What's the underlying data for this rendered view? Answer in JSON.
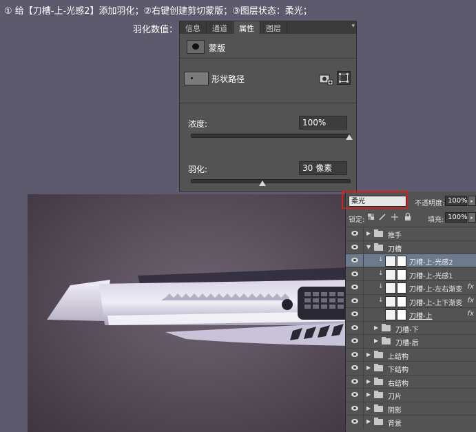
{
  "instruction": "① 给【刀槽-上-光感2】添加羽化；②右键创建剪切蒙版；③图层状态：柔光；",
  "feather_label": "羽化数值：",
  "properties_panel": {
    "tabs": [
      "信息",
      "通道",
      "属性",
      "图层"
    ],
    "active_tab": "属性",
    "mask_label": "蒙版",
    "shape_path_label": "形状路径",
    "density_label": "浓度:",
    "density_value": "100%",
    "density_level": 100,
    "feather_label": "羽化:",
    "feather_value": "30 像素",
    "feather_level": 0.45
  },
  "layers_panel": {
    "blend_mode": "柔光",
    "opacity_label": "不透明度:",
    "opacity_value": "100%",
    "lock_label": "锁定:",
    "fill_label": "填充:",
    "fill_value": "100%",
    "layers": [
      {
        "name": "推手",
        "type": "folder",
        "indent": 0,
        "open": false
      },
      {
        "name": "刀槽",
        "type": "folder",
        "indent": 0,
        "open": true
      },
      {
        "name": "刀槽-上-光感2",
        "type": "layer",
        "indent": 1,
        "clip": true,
        "selected": true,
        "fx": false
      },
      {
        "name": "刀槽-上-光感1",
        "type": "layer",
        "indent": 1,
        "clip": true,
        "fx": false
      },
      {
        "name": "刀槽-上-左右渐变",
        "type": "layer",
        "indent": 1,
        "clip": true,
        "fx": true
      },
      {
        "name": "刀槽-上-上下渐变",
        "type": "layer",
        "indent": 1,
        "clip": true,
        "fx": true
      },
      {
        "name": "刀槽-上",
        "type": "layer",
        "indent": 1,
        "clip": false,
        "fx": true
      },
      {
        "name": "刀槽-下",
        "type": "folder",
        "indent": 1,
        "open": false
      },
      {
        "name": "刀槽-后",
        "type": "folder",
        "indent": 1,
        "open": false
      },
      {
        "name": "上结构",
        "type": "folder",
        "indent": 0,
        "open": false
      },
      {
        "name": "下结构",
        "type": "folder",
        "indent": 0,
        "open": false
      },
      {
        "name": "右结构",
        "type": "folder",
        "indent": 0,
        "open": false
      },
      {
        "name": "刀片",
        "type": "folder",
        "indent": 0,
        "open": false
      },
      {
        "name": "阴影",
        "type": "folder",
        "indent": 0,
        "open": false
      },
      {
        "name": "背景",
        "type": "folder",
        "indent": 0,
        "open": false
      }
    ]
  },
  "colors": {
    "background": "#5e5a6e",
    "panel": "#535353",
    "highlight": "#d12020",
    "selected_row": "#6b7a8c"
  }
}
